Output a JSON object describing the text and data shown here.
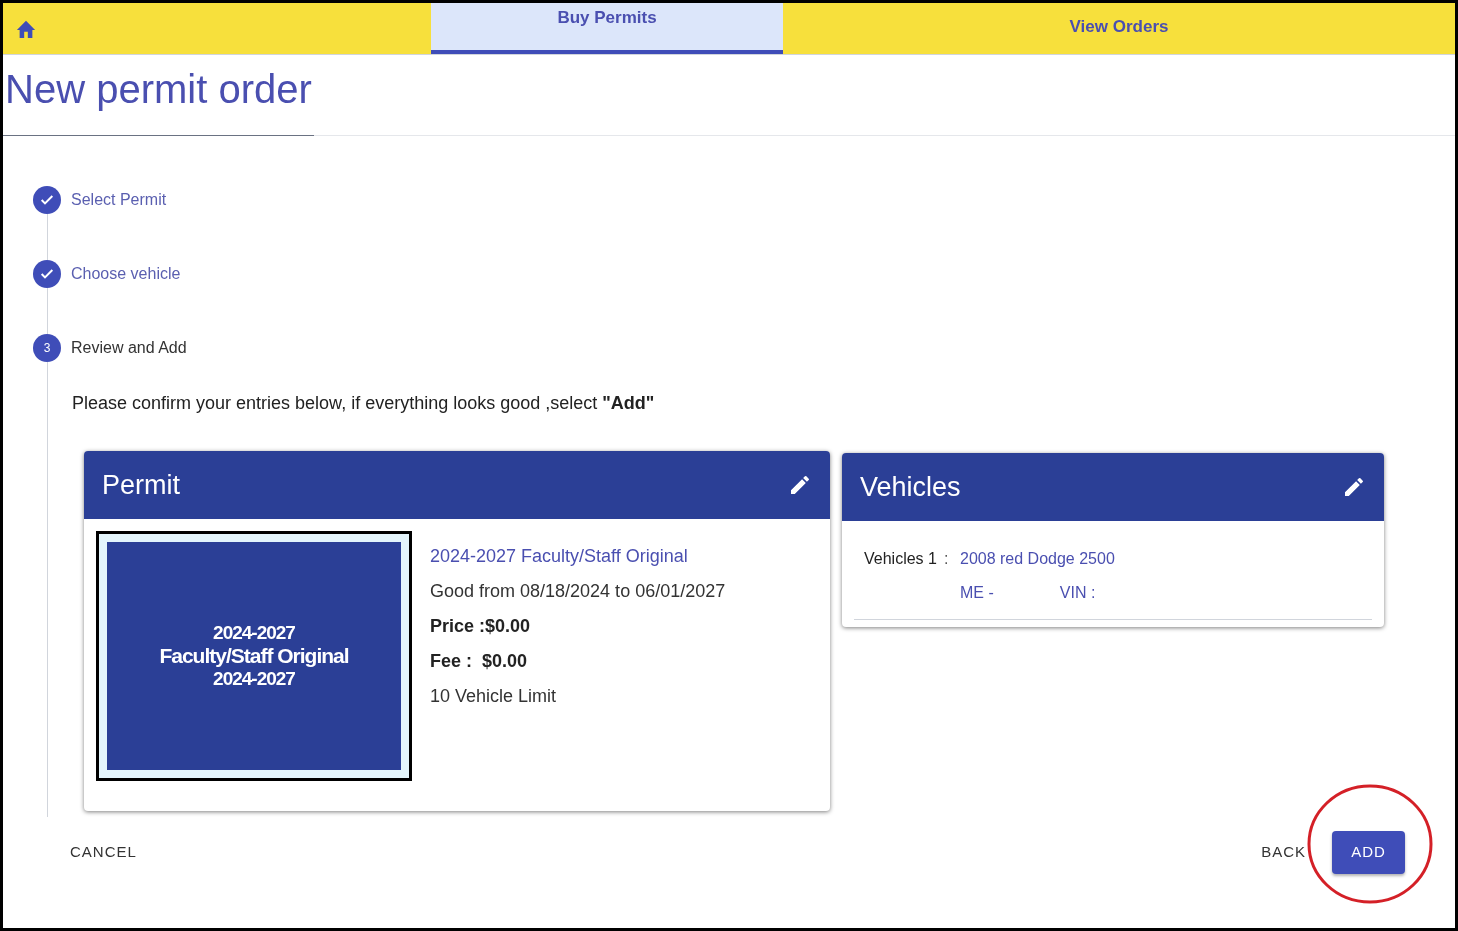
{
  "nav": {
    "tabs": [
      {
        "label": "Buy Permits",
        "selected": true
      },
      {
        "label": "View Orders",
        "selected": false
      }
    ]
  },
  "title": "New permit order",
  "steps": [
    {
      "label": "Select Permit",
      "completed": true
    },
    {
      "label": "Choose vehicle",
      "completed": true
    },
    {
      "marker": "3",
      "label": "Review and Add",
      "completed": false
    }
  ],
  "instructions": "Please confirm your entries below, if everything looks good ,select **\"Add\"**",
  "permit_card": {
    "title": "Permit",
    "image_lines": [
      "2024-2027",
      "Faculty/Staff Original",
      "2024-2027"
    ],
    "name": "2024-2027 Faculty/Staff Original",
    "validity": "Good from 08/18/2024 to 06/01/2027",
    "price": "Price :$0.00",
    "fee": "Fee :  $0.00",
    "limit": "10 Vehicle Limit"
  },
  "vehicles_card": {
    "title": "Vehicles",
    "vehicles": [
      {
        "label": "Vehicles 1",
        "separator": ":",
        "description": "2008 red Dodge 2500",
        "plate": "ME -",
        "vin": "VIN :"
      }
    ]
  },
  "buttons": {
    "cancel": "CANCEL",
    "back": "BACK",
    "add": "ADD"
  },
  "annotation": {
    "kind": "circle",
    "color": "#d42027"
  }
}
